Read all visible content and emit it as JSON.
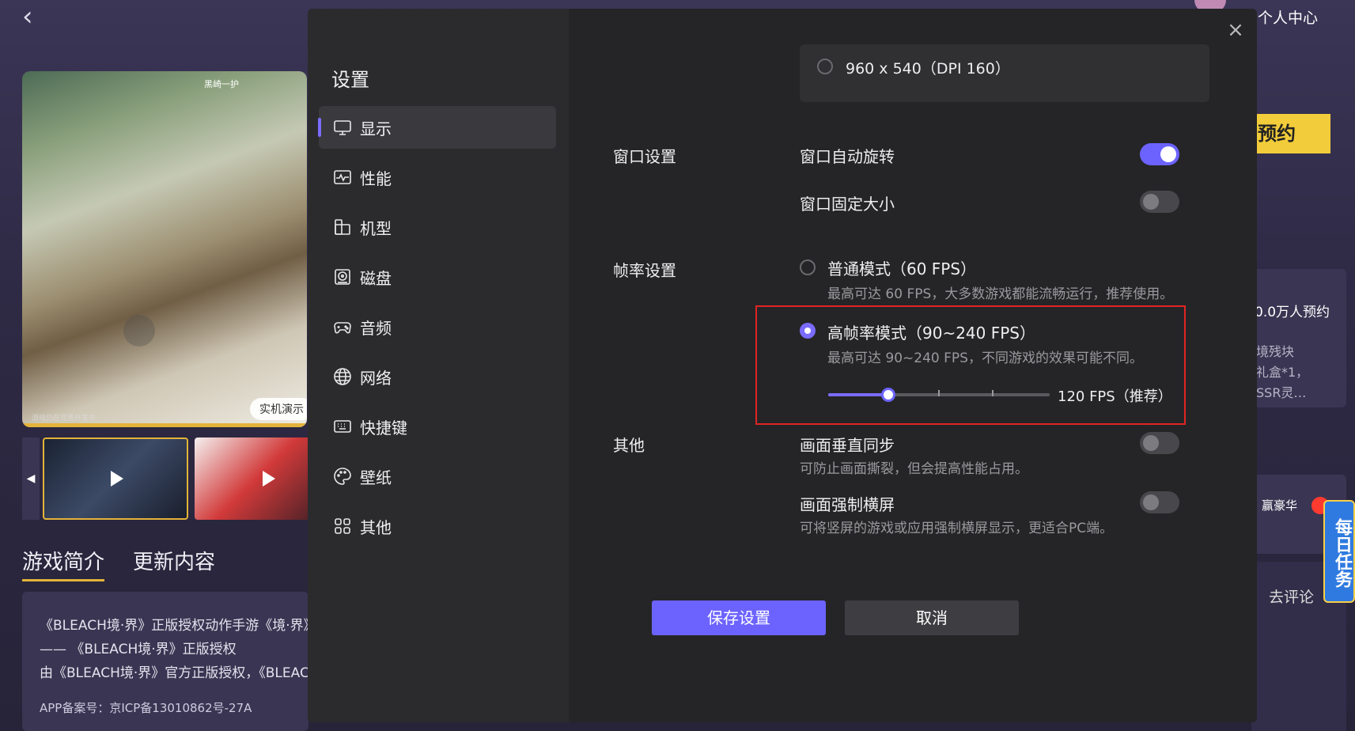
{
  "background": {
    "media_hud_text": "黑崎一护",
    "media_tag": "实机演示",
    "media_watermark": "游戏仍在完善开发中",
    "tabs": [
      {
        "label": "游戏简介"
      },
      {
        "label": "更新内容"
      }
    ],
    "description_lines": [
      "《BLEACH境·界》正版授权动作手游《境·界》",
      "—— 《BLEACH境·界》正版授权",
      "由《BLEACH境·界》官方正版授权，《BLEAC"
    ],
    "icp": "APP备案号：京ICP备13010862号-27A",
    "right": {
      "user_center": "个人中心",
      "reserve_button": "预约",
      "reserve_count": "0.0万人预约",
      "gift_text": "境残块\n礼盒*1，\nSSR灵…",
      "news_text": "】赢豪华",
      "comment_link": "去评论",
      "daily_task": "每日任务"
    }
  },
  "dialog": {
    "title": "设置",
    "nav": [
      {
        "label": "显示",
        "icon": "monitor-icon",
        "active": true
      },
      {
        "label": "性能",
        "icon": "performance-icon"
      },
      {
        "label": "机型",
        "icon": "device-model-icon"
      },
      {
        "label": "磁盘",
        "icon": "disk-icon"
      },
      {
        "label": "音频",
        "icon": "gamepad-icon"
      },
      {
        "label": "网络",
        "icon": "globe-icon"
      },
      {
        "label": "快捷键",
        "icon": "keyboard-icon"
      },
      {
        "label": "壁纸",
        "icon": "palette-icon"
      },
      {
        "label": "其他",
        "icon": "grid-icon"
      }
    ],
    "resolution_option": "960 x 540（DPI 160）",
    "window_section": {
      "label": "窗口设置",
      "auto_rotate": {
        "label": "窗口自动旋转",
        "on": true
      },
      "fixed_size": {
        "label": "窗口固定大小",
        "on": false
      }
    },
    "fps_section": {
      "label": "帧率设置",
      "normal": {
        "label": "普通模式（60 FPS）",
        "desc": "最高可达 60 FPS，大多数游戏都能流畅运行，推荐使用。",
        "selected": false
      },
      "high": {
        "label": "高帧率模式（90~240 FPS）",
        "desc": "最高可达 90~240 FPS，不同游戏的效果可能不同。",
        "selected": true
      },
      "slider": {
        "value_label": "120 FPS（推荐）",
        "fraction": 0.27
      }
    },
    "other_section": {
      "label": "其他",
      "vsync": {
        "label": "画面垂直同步",
        "desc": "可防止画面撕裂，但会提高性能占用。",
        "on": false
      },
      "force_landscape": {
        "label": "画面强制横屏",
        "desc": "可将竖屏的游戏或应用强制横屏显示，更适合PC端。",
        "on": false
      }
    },
    "buttons": {
      "save": "保存设置",
      "cancel": "取消"
    },
    "accent_color": "#6c63ff",
    "highlight_color": "#e02424"
  }
}
